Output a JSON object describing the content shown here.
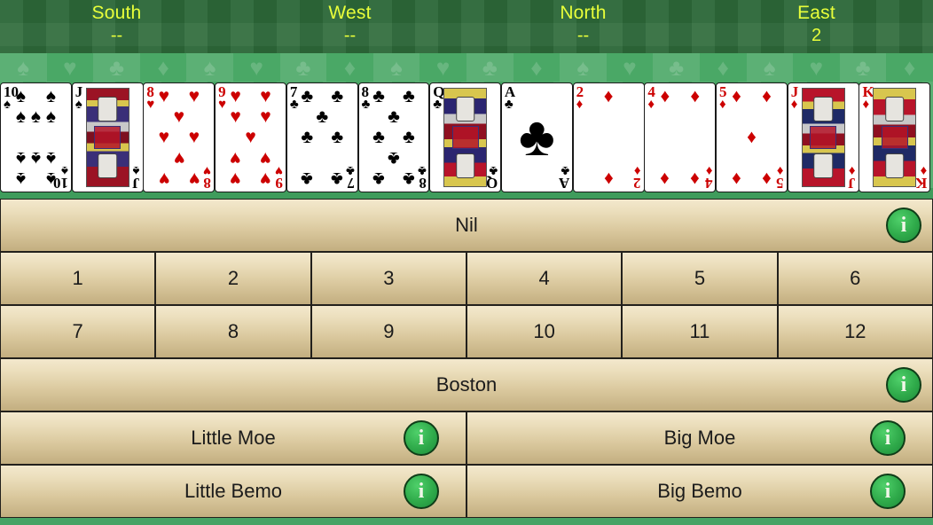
{
  "header": {
    "seats": [
      {
        "name": "South",
        "bid": "--"
      },
      {
        "name": "West",
        "bid": "--"
      },
      {
        "name": "North",
        "bid": "--"
      },
      {
        "name": "East",
        "bid": "2"
      }
    ]
  },
  "suit_band": {
    "glyphs": [
      "♠",
      "♥",
      "♣",
      "♦",
      "♠",
      "♥",
      "♣",
      "♦",
      "♠",
      "♥",
      "♣",
      "♦",
      "♠",
      "♥",
      "♣",
      "♦",
      "♠",
      "♥",
      "♣",
      "♦"
    ]
  },
  "hand": {
    "cards": [
      {
        "rank": "10",
        "suit": "♠",
        "suit_name": "spades",
        "color": "black",
        "kind": "pip",
        "count": 10
      },
      {
        "rank": "J",
        "suit": "♠",
        "suit_name": "spades",
        "color": "black",
        "kind": "face",
        "art": "jspade"
      },
      {
        "rank": "8",
        "suit": "♥",
        "suit_name": "hearts",
        "color": "red",
        "kind": "pip",
        "count": 8
      },
      {
        "rank": "9",
        "suit": "♥",
        "suit_name": "hearts",
        "color": "red",
        "kind": "pip",
        "count": 9
      },
      {
        "rank": "7",
        "suit": "♣",
        "suit_name": "clubs",
        "color": "black",
        "kind": "pip",
        "count": 7
      },
      {
        "rank": "8",
        "suit": "♣",
        "suit_name": "clubs",
        "color": "black",
        "kind": "pip",
        "count": 8
      },
      {
        "rank": "Q",
        "suit": "♣",
        "suit_name": "clubs",
        "color": "black",
        "kind": "face",
        "art": "qclub"
      },
      {
        "rank": "A",
        "suit": "♣",
        "suit_name": "clubs",
        "color": "black",
        "kind": "ace",
        "count": 1
      },
      {
        "rank": "2",
        "suit": "♦",
        "suit_name": "diamonds",
        "color": "red",
        "kind": "pip",
        "count": 2
      },
      {
        "rank": "4",
        "suit": "♦",
        "suit_name": "diamonds",
        "color": "red",
        "kind": "pip",
        "count": 4
      },
      {
        "rank": "5",
        "suit": "♦",
        "suit_name": "diamonds",
        "color": "red",
        "kind": "pip",
        "count": 5
      },
      {
        "rank": "J",
        "suit": "♦",
        "suit_name": "diamonds",
        "color": "red",
        "kind": "face",
        "art": "jdiam"
      },
      {
        "rank": "K",
        "suit": "♦",
        "suit_name": "diamonds",
        "color": "red",
        "kind": "face",
        "art": "kdiam"
      }
    ]
  },
  "bidding": {
    "nil": {
      "label": "Nil",
      "info": "i"
    },
    "numbers": [
      "1",
      "2",
      "3",
      "4",
      "5",
      "6",
      "7",
      "8",
      "9",
      "10",
      "11",
      "12"
    ],
    "boston": {
      "label": "Boston",
      "info": "i"
    },
    "specials": [
      {
        "label": "Little Moe",
        "info": "i"
      },
      {
        "label": "Big Moe",
        "info": "i"
      },
      {
        "label": "Little Bemo",
        "info": "i"
      },
      {
        "label": "Big Bemo",
        "info": "i"
      }
    ]
  },
  "colors": {
    "header_green": "#2e6b3a",
    "felt_green": "#4aa866",
    "button_top": "#f3e8cd",
    "button_bottom": "#c3ae80",
    "seat_text": "#e8ff3a",
    "info_green": "#2faa4a",
    "red_suit": "#cc0000"
  }
}
